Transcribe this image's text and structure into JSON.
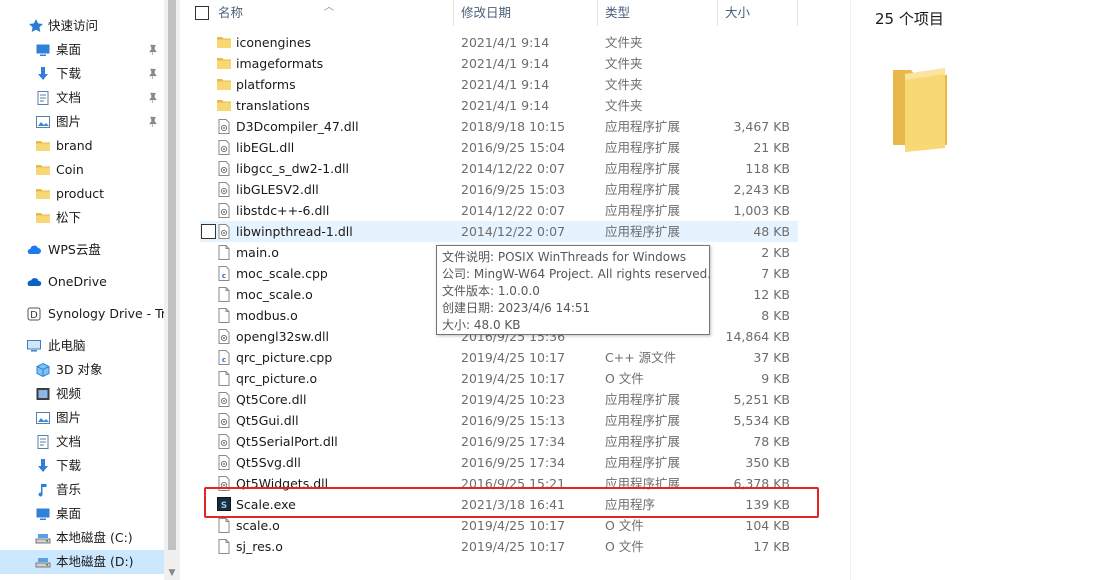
{
  "nav": {
    "quick_access": "快速访问",
    "items": [
      {
        "label": "桌面",
        "icon": "desktop-icon",
        "pinned": true
      },
      {
        "label": "下载",
        "icon": "download-icon",
        "pinned": true
      },
      {
        "label": "文档",
        "icon": "document-icon",
        "pinned": true
      },
      {
        "label": "图片",
        "icon": "picture-icon",
        "pinned": true
      },
      {
        "label": "brand",
        "icon": "folder-icon",
        "pinned": false
      },
      {
        "label": "Coin",
        "icon": "folder-icon",
        "pinned": false
      },
      {
        "label": "product",
        "icon": "folder-icon",
        "pinned": false
      },
      {
        "label": "松下",
        "icon": "folder-icon",
        "pinned": false
      }
    ],
    "wps_cloud": "WPS云盘",
    "onedrive": "OneDrive",
    "synology": "Synology Drive - Tr",
    "this_pc": "此电脑",
    "pc_items": [
      {
        "label": "3D 对象",
        "icon": "3d-objects-icon"
      },
      {
        "label": "视频",
        "icon": "video-icon"
      },
      {
        "label": "图片",
        "icon": "picture-icon"
      },
      {
        "label": "文档",
        "icon": "document-icon"
      },
      {
        "label": "下载",
        "icon": "download-icon"
      },
      {
        "label": "音乐",
        "icon": "music-icon"
      },
      {
        "label": "桌面",
        "icon": "desktop-icon"
      },
      {
        "label": "本地磁盘 (C:)",
        "icon": "drive-icon"
      },
      {
        "label": "本地磁盘 (D:)",
        "icon": "drive-icon"
      }
    ]
  },
  "columns": {
    "name": "名称",
    "date": "修改日期",
    "type": "类型",
    "size": "大小"
  },
  "files": [
    {
      "name": "iconengines",
      "date": "2021/4/1 9:14",
      "type": "文件夹",
      "size": "",
      "kind": "folder"
    },
    {
      "name": "imageformats",
      "date": "2021/4/1 9:14",
      "type": "文件夹",
      "size": "",
      "kind": "folder"
    },
    {
      "name": "platforms",
      "date": "2021/4/1 9:14",
      "type": "文件夹",
      "size": "",
      "kind": "folder"
    },
    {
      "name": "translations",
      "date": "2021/4/1 9:14",
      "type": "文件夹",
      "size": "",
      "kind": "folder"
    },
    {
      "name": "D3Dcompiler_47.dll",
      "date": "2018/9/18 10:15",
      "type": "应用程序扩展",
      "size": "3,467 KB",
      "kind": "dll"
    },
    {
      "name": "libEGL.dll",
      "date": "2016/9/25 15:04",
      "type": "应用程序扩展",
      "size": "21 KB",
      "kind": "dll"
    },
    {
      "name": "libgcc_s_dw2-1.dll",
      "date": "2014/12/22 0:07",
      "type": "应用程序扩展",
      "size": "118 KB",
      "kind": "dll"
    },
    {
      "name": "libGLESV2.dll",
      "date": "2016/9/25 15:03",
      "type": "应用程序扩展",
      "size": "2,243 KB",
      "kind": "dll"
    },
    {
      "name": "libstdc++-6.dll",
      "date": "2014/12/22 0:07",
      "type": "应用程序扩展",
      "size": "1,003 KB",
      "kind": "dll"
    },
    {
      "name": "libwinpthread-1.dll",
      "date": "2014/12/22 0:07",
      "type": "应用程序扩展",
      "size": "48 KB",
      "kind": "dll"
    },
    {
      "name": "main.o",
      "date": "",
      "type": "",
      "size": "2 KB",
      "kind": "file"
    },
    {
      "name": "moc_scale.cpp",
      "date": "",
      "type": "",
      "size": "7 KB",
      "kind": "cpp"
    },
    {
      "name": "moc_scale.o",
      "date": "",
      "type": "",
      "size": "12 KB",
      "kind": "file"
    },
    {
      "name": "modbus.o",
      "date": "",
      "type": "",
      "size": "8 KB",
      "kind": "file"
    },
    {
      "name": "opengl32sw.dll",
      "date": "2016/9/25 15:36",
      "type": "",
      "size": "14,864 KB",
      "kind": "dll"
    },
    {
      "name": "qrc_picture.cpp",
      "date": "2019/4/25 10:17",
      "type": "C++ 源文件",
      "size": "37 KB",
      "kind": "cpp"
    },
    {
      "name": "qrc_picture.o",
      "date": "2019/4/25 10:17",
      "type": "O 文件",
      "size": "9 KB",
      "kind": "file"
    },
    {
      "name": "Qt5Core.dll",
      "date": "2019/4/25 10:23",
      "type": "应用程序扩展",
      "size": "5,251 KB",
      "kind": "dll"
    },
    {
      "name": "Qt5Gui.dll",
      "date": "2016/9/25 15:13",
      "type": "应用程序扩展",
      "size": "5,534 KB",
      "kind": "dll"
    },
    {
      "name": "Qt5SerialPort.dll",
      "date": "2016/9/25 17:34",
      "type": "应用程序扩展",
      "size": "78 KB",
      "kind": "dll"
    },
    {
      "name": "Qt5Svg.dll",
      "date": "2016/9/25 17:34",
      "type": "应用程序扩展",
      "size": "350 KB",
      "kind": "dll"
    },
    {
      "name": "Qt5Widgets.dll",
      "date": "2016/9/25 15:21",
      "type": "应用程序扩展",
      "size": "6,378 KB",
      "kind": "dll"
    },
    {
      "name": "Scale.exe",
      "date": "2021/3/18 16:41",
      "type": "应用程序",
      "size": "139 KB",
      "kind": "exe"
    },
    {
      "name": "scale.o",
      "date": "2019/4/25 10:17",
      "type": "O 文件",
      "size": "104 KB",
      "kind": "file"
    },
    {
      "name": "sj_res.o",
      "date": "2019/4/25 10:17",
      "type": "O 文件",
      "size": "17 KB",
      "kind": "file"
    }
  ],
  "tooltip": {
    "description": "文件说明: POSIX WinThreads for Windows",
    "company": "公司: MingW-W64 Project. All rights reserved.",
    "version": "文件版本: 1.0.0.0",
    "created": "创建日期: 2023/4/6 14:51",
    "size": "大小: 48.0 KB"
  },
  "preview": {
    "count": "25 个项目"
  },
  "colors": {
    "selection": "#cce8ff",
    "hover": "#e5f3ff",
    "highlight_box": "#e52424",
    "folder": "#f8d775"
  }
}
